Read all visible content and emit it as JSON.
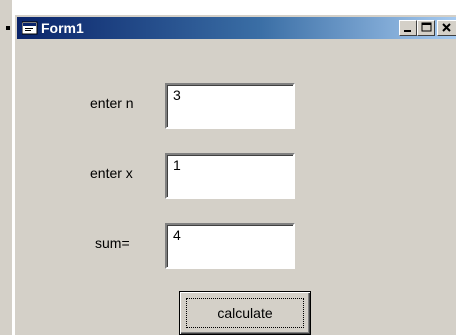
{
  "window": {
    "title": "Form1",
    "buttons": {
      "minimize": "minimize-icon",
      "maximize": "maximize-icon",
      "close": "close-icon"
    }
  },
  "form": {
    "fields": [
      {
        "label": "enter n",
        "value": "3"
      },
      {
        "label": "enter x",
        "value": "1"
      },
      {
        "label": "sum=",
        "value": "4"
      }
    ],
    "calculate_label": "calculate"
  },
  "colors": {
    "face": "#d4d0c8",
    "titlebar_start": "#0a246a",
    "titlebar_end": "#a6caf0",
    "title_text": "#ffffff"
  }
}
